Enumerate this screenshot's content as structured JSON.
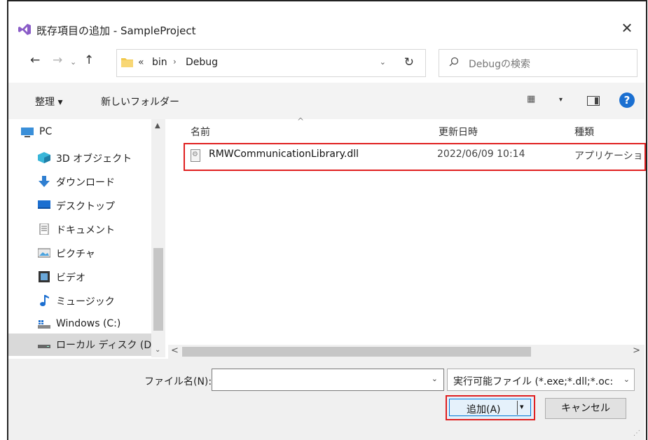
{
  "window": {
    "title": "既存項目の追加 - SampleProject",
    "close_glyph": "✕"
  },
  "nav": {
    "back": "←",
    "forward": "→",
    "dropdown": "⌄",
    "up": "↑"
  },
  "address": {
    "overflow": "«",
    "segments": [
      "bin",
      "Debug"
    ],
    "separator": "›",
    "dropdown": "⌄",
    "refresh": "↻"
  },
  "search": {
    "placeholder": "Debugの検索"
  },
  "toolbar": {
    "organize": "整理 ▾",
    "new_folder": "新しいフォルダー",
    "view_glyph": "▦",
    "view_dd": "▾",
    "help": "?"
  },
  "sidebar": {
    "items": [
      {
        "label": "PC",
        "icon": "pc-icon"
      },
      {
        "label": "3D オブジェクト",
        "icon": "3d-objects-icon"
      },
      {
        "label": "ダウンロード",
        "icon": "download-icon"
      },
      {
        "label": "デスクトップ",
        "icon": "desktop-icon"
      },
      {
        "label": "ドキュメント",
        "icon": "documents-icon"
      },
      {
        "label": "ピクチャ",
        "icon": "pictures-icon"
      },
      {
        "label": "ビデオ",
        "icon": "video-icon"
      },
      {
        "label": "ミュージック",
        "icon": "music-icon"
      },
      {
        "label": "Windows (C:)",
        "icon": "windows-drive-icon"
      },
      {
        "label": "ローカル ディスク (D",
        "icon": "local-disk-icon"
      }
    ]
  },
  "files": {
    "columns": {
      "name": "名前",
      "date": "更新日時",
      "type": "種類"
    },
    "sort_caret": "^",
    "rows": [
      {
        "name": "RMWCommunicationLibrary.dll",
        "date": "2022/06/09 10:14",
        "type": "アプリケーション"
      }
    ]
  },
  "scroll": {
    "up": "▲",
    "down": "⌄",
    "left": "<",
    "right": ">"
  },
  "bottom": {
    "filename_label": "ファイル名(N):",
    "filename_value": "",
    "filename_dd": "⌄",
    "filter_value": "実行可能ファイル (*.exe;*.dll;*.oc:",
    "filter_dd": "⌄",
    "add_label": "追加(A)",
    "add_arrow": "▾",
    "cancel_label": "キャンセル"
  },
  "colors": {
    "highlight": "#e02020",
    "accent": "#0078d7",
    "help": "#1a6fd1"
  }
}
